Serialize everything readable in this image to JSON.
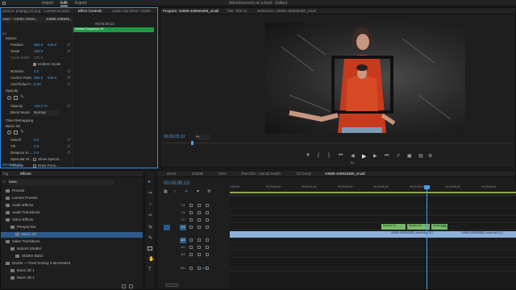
{
  "menu": {
    "items": [
      "Import",
      "Edit",
      "Export"
    ],
    "active": "Edit",
    "app_title": "Advertisement at school - Edited"
  },
  "left_panel": {
    "tabs": [
      "Source: pngegg (1).png",
      "Lumetri Scopes",
      "Effect Controls",
      "Audio Clip Mixer: 44686"
    ],
    "active_tab": "Effect Controls",
    "header_label": "aster * 44686-43994...",
    "header_clip": "44686-439946...",
    "timecode": "00;00;05;13",
    "nested_seq": "Nested Sequence 19",
    "section_video": "eo",
    "motion": {
      "title": "Motion",
      "position_label": "Position",
      "position_x": "960.0",
      "position_y": "540.0",
      "scale_label": "Scale",
      "scale_value": "100.0",
      "scale_width_label": "Scale Width",
      "scale_width_value": "100.0",
      "uniform_label": "Uniform Scale",
      "rotation_label": "Rotation",
      "rotation_value": "0.0",
      "anchor_label": "Anchor Point",
      "anchor_x": "960.0",
      "anchor_y": "540.0",
      "antiflicker_label": "Anti-flicker F...",
      "antiflicker_value": "0.00"
    },
    "opacity": {
      "title": "Opacity",
      "opacity_label": "Opacity",
      "opacity_value": "100.0 %",
      "blend_label": "Blend Mode",
      "blend_value": "Normal"
    },
    "time_remap": "Time Remapping",
    "basic3d": {
      "title": "Basic 3D",
      "swivel_label": "Swivel",
      "swivel_value": "0.0",
      "tilt_label": "Tilt",
      "tilt_value": "0.0",
      "distance_label": "Distance to ...",
      "distance_value": "0.0",
      "specular_label": "Specular Hi...",
      "specular_check": "Show Specul...",
      "preview_label": "Preview",
      "preview_check": "Draw Previ..."
    },
    "footer_tc": "00;00;05;13"
  },
  "program_monitor": {
    "tabs": [
      "Program: 44686-439946368_small",
      "Title: Title 01",
      "Reference: 44686-439946368_small"
    ],
    "active_tab": "Program: 44686-439946368_small",
    "timecode": "00;00;05;13",
    "fit": "Fit"
  },
  "effects_panel": {
    "tabs": [
      "fog",
      "Effects"
    ],
    "active_tab": "Effects",
    "search_value": "basic",
    "items": [
      {
        "label": "Presets",
        "indent": 0
      },
      {
        "label": "Lumetri Presets",
        "indent": 0
      },
      {
        "label": "Audio Effects",
        "indent": 0
      },
      {
        "label": "Audio Transitions",
        "indent": 0
      },
      {
        "label": "Video Effects",
        "indent": 0
      },
      {
        "label": "Perspective",
        "indent": 1
      },
      {
        "label": "Basic 3D",
        "indent": 2,
        "selected": true
      },
      {
        "label": "Video Transitions",
        "indent": 0
      },
      {
        "label": "Natroni Shatter",
        "indent": 1
      },
      {
        "label": "Shatter Basic",
        "indent": 2
      },
      {
        "label": "DILEN — Pixel Sorting 3 MA204944",
        "indent": 0
      },
      {
        "label": "Basic 3D 1",
        "indent": 1
      },
      {
        "label": "Basic 3D 2",
        "indent": 1
      }
    ]
  },
  "timeline": {
    "tabs": [
      "drone",
      "Gitdabr",
      "SSO",
      "short film : mental health",
      "for lovely",
      "44686-439946368_small"
    ],
    "active_tab": "44686-439946368_small",
    "timecode": "00;00;05;13",
    "ruler": [
      "0;00;00",
      "00;00;04;00",
      "00;00;04;18",
      "00;00;05;00",
      "00;00;05;06",
      "00;00;05;12",
      "00;00;05;18",
      "00;00;06;00"
    ],
    "tracks": {
      "video": [
        "V4",
        "V3",
        "V2",
        "V1"
      ],
      "audio": [
        "A1",
        "A2",
        "A3"
      ],
      "mix": "Mix",
      "mix_value": "0.0"
    },
    "clips": {
      "nested1": "Nested Se",
      "nested2": "Nested Se",
      "nested3": "Nested Se",
      "main": "44686-439946368_small.mp4 [V]",
      "main2": "44686-439946368_small.mp4 [V]",
      "main3": "44686-439946368_small.mp4 [V]"
    }
  },
  "colors": {
    "accent": "#2d8ceb",
    "green_clip": "#1e9b44",
    "video_clip": "#8fb0d8",
    "nested_clip": "#76b86a",
    "selected_row": "#2d5a8a"
  }
}
